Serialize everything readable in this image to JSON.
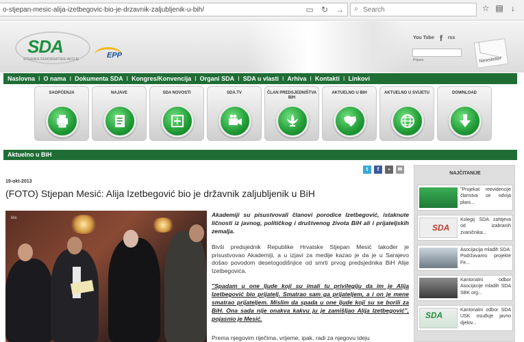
{
  "browser": {
    "url": "o-stjepan-mesic-alija-izetbegovic-bio-je-drzavnik-zaljubljenik-u-bih/",
    "search_placeholder": "Search"
  },
  "header": {
    "logo_text": "SDA",
    "logo_subtext": "STRANKA DEMOKRATSKE AKCIJE",
    "epp_text": "EPP",
    "social": [
      "You Tube",
      "f",
      "rss"
    ],
    "small_text": "Prijava",
    "newsletter_label": "Newsletter"
  },
  "nav": {
    "items": [
      "Naslovna",
      "O nama",
      "Dokumenta SDA",
      "Kongres/Konvencija",
      "Organi SDA",
      "SDA u vlasti",
      "Arhiva",
      "Kontakti",
      "Linkovi"
    ]
  },
  "tiles": [
    {
      "label": "SAOPĆENJA",
      "icon": "printer-icon"
    },
    {
      "label": "NAJAVE",
      "icon": "document-icon"
    },
    {
      "label": "SDA NOVOSTI",
      "icon": "add-document-icon"
    },
    {
      "label": "SDA.TV",
      "icon": "video-camera-icon"
    },
    {
      "label": "ČLAN PREDSJEDNIŠTVA BIH",
      "icon": "fleur-de-lis-icon"
    },
    {
      "label": "AKTUELNO U BIH",
      "icon": "bih-map-icon"
    },
    {
      "label": "AKTUELNO U SVIJETU",
      "icon": "globe-icon"
    },
    {
      "label": "DOWNLOAD",
      "icon": "download-arrow-icon"
    }
  ],
  "section_title": "Aktuelno u BiH",
  "article": {
    "date": "19-okt-2013",
    "title": "(FOTO) Stjepan Mesić: Alija Izetbegović bio je državnik zaljubljenik u BiH",
    "photo_tag": "klix",
    "lead": "Akademiji su pisustvovali članovi porodice Izetbegović, istaknute ličnosti iz javnog, političkog i društvenog života BiH ali i prijateljskih zemalja.",
    "paragraph1": "Bivši predsjednik Republike Hrvatske Stjepan Mesić također je prisustvovao Akademiji, a u izjavi za medije kazao je da je u Sarajevo došao povodom desetogodišnjice od smrti prvog predsjednika BiH Alije Izetbegovića.",
    "quote": "\"Spadam u one ljude koji su imali tu privilegiju da im je Alija Izetbegović bio prijatelj. Smatrao sam ga prijateljem, a i on je mene smatrao prijateljem. Mislim da spada u one ljude koji su se borili za BiH. Ona sada nije onakva kakvu ju je zamišljao Alija Izetbegović\", pojasnio je Mesić.",
    "paragraph2": "Prema njegovim riječima, vrijeme, ipak, radi za njegovu ideju"
  },
  "sidebar": {
    "title": "NAJČITANIJE",
    "items": [
      "\"Projekat reevidencije članstva se odvija plani...",
      "Kolegij SDA zahtjeva od izabranih zvaničnika...",
      "Asocijacija mladih SDA: Podržavamo projekte Fe...",
      "Kantonalni odbor Asocijacije mladih SDA SBK org...",
      "Kantonalni odbor SDA USK osuđuje javno djelov..."
    ],
    "thumb_labels": [
      "SDA",
      "SDA"
    ]
  },
  "colors": {
    "nav_green": "#1f6d35",
    "logo_green": "#1e8f3e",
    "epp_blue": "#1b4d9b"
  }
}
